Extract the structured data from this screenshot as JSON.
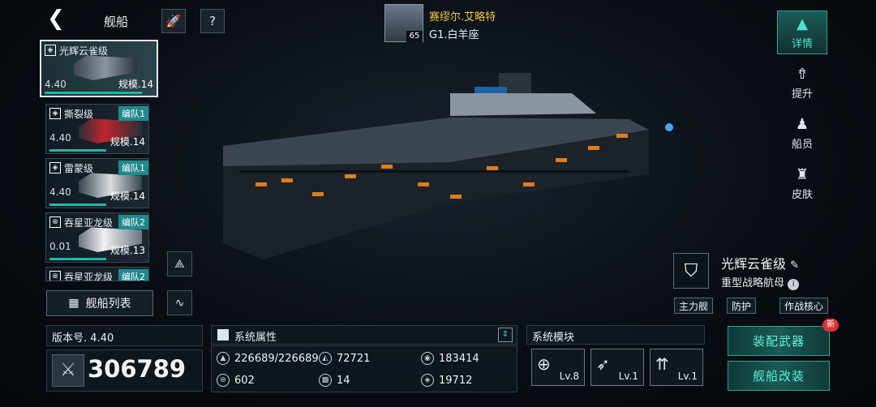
{
  "header": {
    "title": "舰船",
    "back_icon": "chevron-left-icon"
  },
  "commander": {
    "name": "赛缪尔.艾略特",
    "level": "65",
    "constellation": "G1.白羊座"
  },
  "ship_list": [
    {
      "name": "光辉云雀级",
      "power": "4.40",
      "scale": "规模.14",
      "fleet": "",
      "bar": 0.85
    },
    {
      "name": "撕裂级",
      "power": "4.40",
      "scale": "规模.14",
      "fleet": "编队1",
      "bar": 0.85
    },
    {
      "name": "雷蒙级",
      "power": "4.40",
      "scale": "规模.14",
      "fleet": "编队1",
      "bar": 0.85
    },
    {
      "name": "吞星亚龙级",
      "power": "0.01",
      "scale": "规模.13",
      "fleet": "编队2",
      "bar": 0.6
    },
    {
      "name": "吞星亚龙级",
      "power": "",
      "scale": "",
      "fleet": "编队2",
      "bar": 0
    }
  ],
  "fleet_list_label": "舰船列表",
  "version_label": "版本号. 4.40",
  "combat_power": "306789",
  "attributes": {
    "title": "系统属性",
    "items": [
      "226689/226689",
      "72721",
      "183414",
      "602",
      "14",
      "19712"
    ]
  },
  "modules": {
    "title": "系统模块",
    "levels": [
      "Lv.8",
      "Lv.1",
      "Lv.1"
    ]
  },
  "right_nav": [
    "详情",
    "提升",
    "船员",
    "皮肤"
  ],
  "ship_info": {
    "name": "光辉云雀级",
    "type": "重型战略航母",
    "tags": [
      "主力舰",
      "防护",
      "作战核心"
    ]
  },
  "actions": {
    "equip": "装配武器",
    "refit": "舰船改装",
    "new_badge": "新"
  },
  "colors": {
    "accent": "#2aa39a",
    "name": "#f1c64a"
  }
}
